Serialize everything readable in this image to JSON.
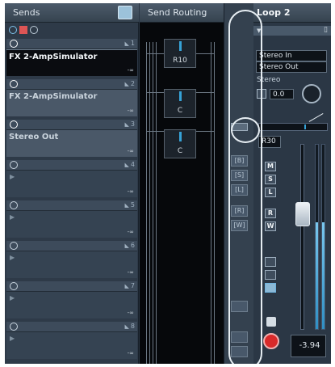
{
  "sends_panel": {
    "title": "Sends",
    "slots": [
      {
        "num": "1",
        "name": "FX 2-AmpSimulator",
        "level": "-∞",
        "power": "on",
        "state": "active"
      },
      {
        "num": "2",
        "name": "FX 2-AmpSimulator",
        "level": "-∞",
        "power": "on",
        "state": "dim"
      },
      {
        "num": "3",
        "name": "Stereo Out",
        "level": "-∞",
        "power": "on",
        "state": "dim"
      },
      {
        "num": "4",
        "name": "",
        "level": "-∞",
        "power": "off",
        "state": "empty"
      },
      {
        "num": "5",
        "name": "",
        "level": "-∞",
        "power": "off",
        "state": "empty"
      },
      {
        "num": "6",
        "name": "",
        "level": "-∞",
        "power": "off",
        "state": "empty"
      },
      {
        "num": "7",
        "name": "",
        "level": "-∞",
        "power": "off",
        "state": "empty"
      },
      {
        "num": "8",
        "name": "",
        "level": "-∞",
        "power": "off",
        "state": "empty"
      }
    ]
  },
  "routing_panel": {
    "title": "Send Routing",
    "boxes": [
      {
        "label": "R10"
      },
      {
        "label": "C"
      },
      {
        "label": "C"
      }
    ]
  },
  "mid_strip": {
    "buttons": [
      "[B]",
      "[S]",
      "[L]",
      "[R]",
      "[W]"
    ]
  },
  "loop_panel": {
    "title": "Loop 2",
    "input": "Stereo In",
    "output": "Stereo Out",
    "mode": "Stereo",
    "pan_value": "0.0",
    "channel_pan": "R30",
    "buttons": [
      "M",
      "S",
      "L",
      "R",
      "W"
    ],
    "volume_readout": "-3.94",
    "meter_level": 0.58,
    "fader_position": 0.64
  },
  "colors": {
    "accent": "#36a2d6",
    "record": "#d92a2a"
  }
}
